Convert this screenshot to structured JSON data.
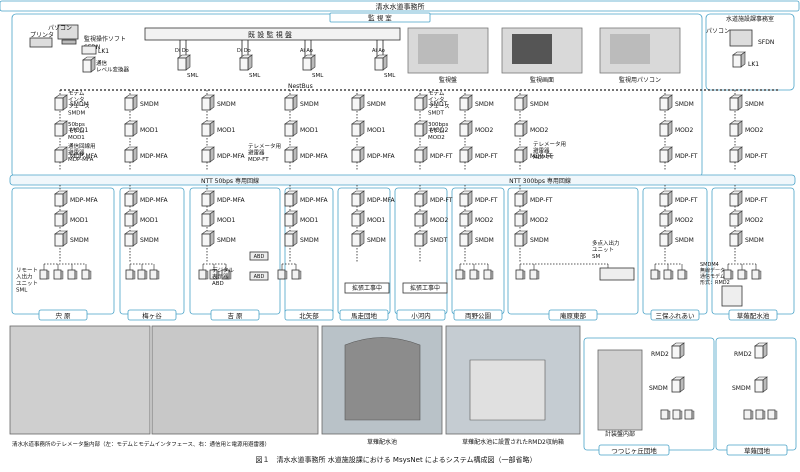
{
  "office_title": "清水水道事務所",
  "control_room": "監 視 室",
  "facility_office": "水道施設課事務室",
  "pc_label": "パソコン",
  "printer_label": "プリンタ",
  "software_label": "監視操作ソフト",
  "sfdn": "SFDN",
  "lk1": "LK1",
  "level_converter": "通信\nレベル変換器",
  "existing_panel": "既 設 監 視 盤",
  "di_do": "Di Do",
  "ai_ao": "Ai Ao",
  "sml": "SML",
  "nestbus": "NestBus",
  "smdm": "SMDM",
  "mod1": "MOD1",
  "mod2": "MOD2",
  "mdp_mfa": "MDP-MFA",
  "mdp_ft": "MDP-FT",
  "smdt": "SMDT",
  "modem_interface": "モデム\nインタ\nフェース\nSMDM",
  "modem_50": "50bps\nモデム\nMOD1",
  "arrester_mfa": "通信回線用\n避雷器\nMDP-MFA",
  "modem_interface2": "モデム\nインタ\nフェース\nSMDT",
  "modem_300": "300bps\nモデム\nMOD2",
  "telemeter_arrester": "テレメータ用\n避雷器\nMDP-FT",
  "telemeter_arrester2": "テレメータ用\n避雷器\nMDP-FT",
  "ntt50": "NTT 50bps 専用回線",
  "ntt300": "NTT 300bps 専用回線",
  "photo1": "監視盤",
  "photo2": "監視画面",
  "photo3": "監視用パソコン",
  "remote_unit": "リモート\n入出力\nユニット\nSML",
  "digital_display": "デジタル\n表示器\nABD",
  "abd": "ABD",
  "multi_unit": "多点入出力\nユニット\nSM",
  "expansion": "拡張工事中",
  "wireless_modem": "SMDM4\n無線データ\n通信モデム\n形式：RMD2",
  "rmd2": "RMD2",
  "sites": [
    "宍 原",
    "梅ヶ谷",
    "吉 原",
    "北矢部",
    "馬走団地",
    "小河内",
    "両野公園",
    "庵原東部",
    "三保ふれあい",
    "草薙配水池"
  ],
  "bottom_sites": [
    "つつじヶ丘団地",
    "草薙団地"
  ],
  "meter_panel": "計装盤内部",
  "caption_photo_left": "清水水道事務所のテレメータ盤内部（左：モデムとモデムインタフェース、右：通信用と電源用避雷器）",
  "caption_tank": "草薙配水池",
  "caption_rmd2": "草薙配水池に設置されたRMD2収納箱",
  "figure_caption": "図１　清水水道事務所 水道施設課における MsysNet によるシステム構成図（一部省略）",
  "colors": {
    "frame": "#4aa3c8",
    "band": "#dfeff7",
    "dash": "#222222"
  }
}
